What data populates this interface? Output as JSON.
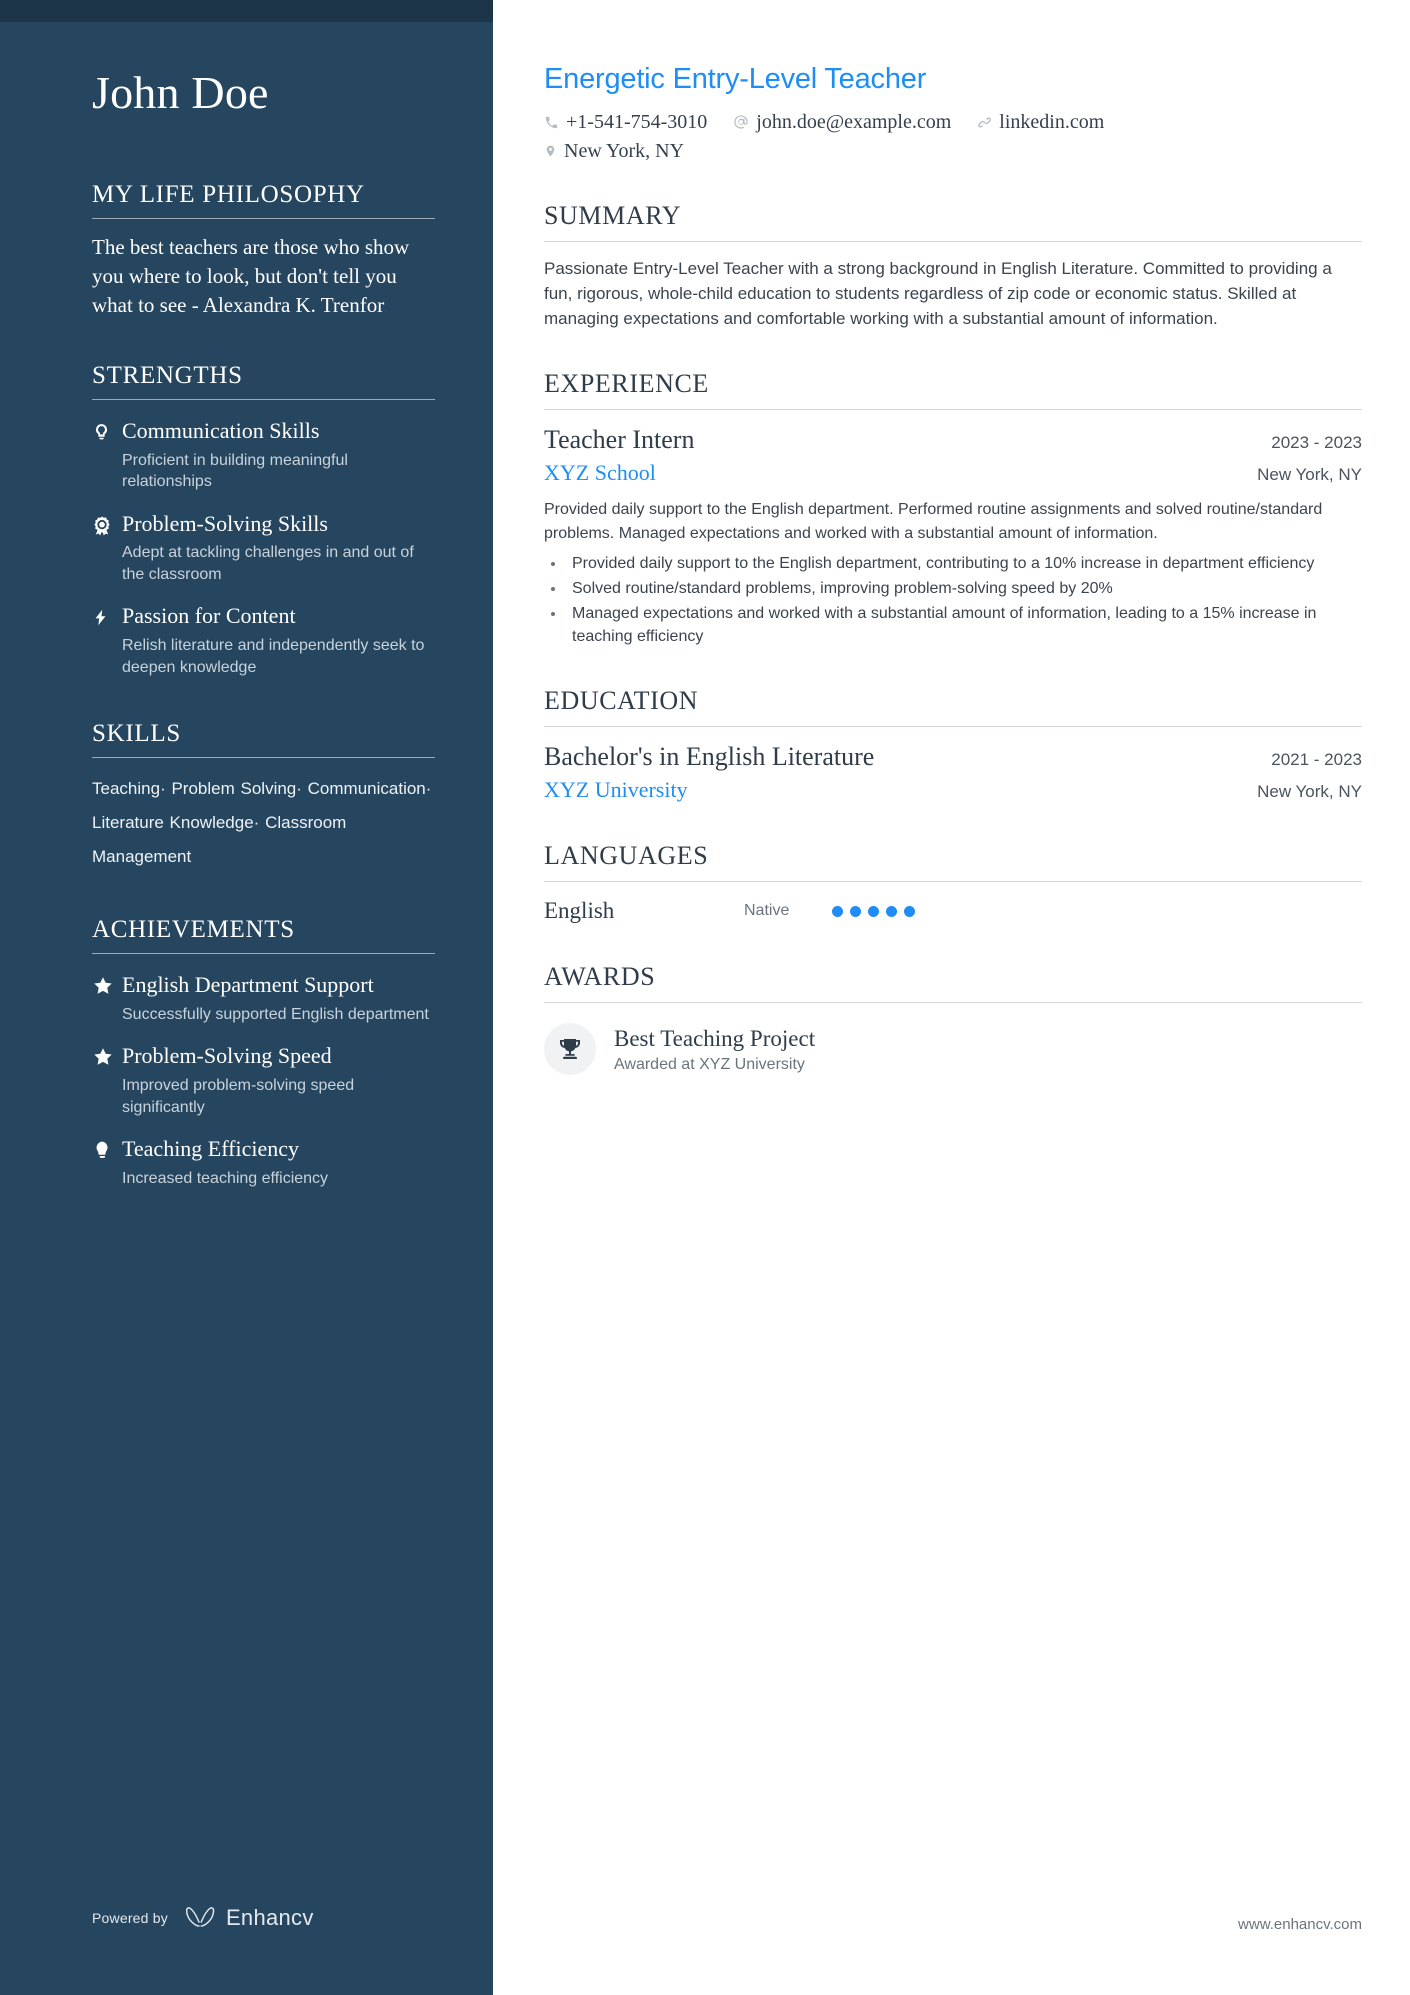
{
  "colors": {
    "sidebar_bg": "#26465f",
    "sidebar_top_band": "#1d3549",
    "accent_blue": "#1e8df5",
    "heading_dark": "#2f3c49",
    "body_text": "#3b444e",
    "muted_text": "#6b747d"
  },
  "sidebar": {
    "name": "John Doe",
    "philosophy": {
      "heading": "MY LIFE PHILOSOPHY",
      "quote": "The best teachers are those who show you where to look, but don't tell you what to see - Alexandra K. Trenfor"
    },
    "strengths": {
      "heading": "STRENGTHS",
      "items": [
        {
          "icon": "lightbulb-icon",
          "title": "Communication Skills",
          "description": "Proficient in building meaningful relationships"
        },
        {
          "icon": "award-ribbon-icon",
          "title": "Problem-Solving Skills",
          "description": "Adept at tackling challenges in and out of the classroom"
        },
        {
          "icon": "lightning-bolt-icon",
          "title": "Passion for Content",
          "description": "Relish literature and independently seek to deepen knowledge"
        }
      ]
    },
    "skills": {
      "heading": "SKILLS",
      "separator": "·",
      "items": [
        "Teaching",
        "Problem Solving",
        "Communication",
        "Literature Knowledge",
        "Classroom Management"
      ]
    },
    "achievements": {
      "heading": "ACHIEVEMENTS",
      "items": [
        {
          "icon": "star-icon",
          "title": "English Department Support",
          "description": "Successfully supported English department"
        },
        {
          "icon": "star-icon",
          "title": "Problem-Solving Speed",
          "description": "Improved problem-solving speed significantly"
        },
        {
          "icon": "lightbulb-idea-icon",
          "title": "Teaching Efficiency",
          "description": "Increased teaching efficiency"
        }
      ]
    },
    "footer": {
      "powered_by": "Powered by",
      "brand": "Enhancv"
    }
  },
  "main": {
    "job_title": "Energetic Entry-Level Teacher",
    "contacts": {
      "phone": {
        "icon": "phone-icon",
        "text": "+1-541-754-3010"
      },
      "email": {
        "icon": "at-email-icon",
        "text": "john.doe@example.com"
      },
      "link": {
        "icon": "link-icon",
        "text": "linkedin.com"
      },
      "location": {
        "icon": "map-pin-icon",
        "text": "New York, NY"
      }
    },
    "summary": {
      "heading": "SUMMARY",
      "text": "Passionate Entry-Level Teacher with a strong background in English Literature. Committed to providing a fun, rigorous, whole-child education to students regardless of zip code or economic status. Skilled at managing expectations and comfortable working with a substantial amount of information."
    },
    "experience": {
      "heading": "EXPERIENCE",
      "items": [
        {
          "title": "Teacher Intern",
          "dates": "2023 - 2023",
          "organization": "XYZ School",
          "location": "New York, NY",
          "description": "Provided daily support to the English department. Performed routine assignments and solved routine/standard problems. Managed expectations and worked with a substantial amount of information.",
          "bullets": [
            "Provided daily support to the English department, contributing to a 10% increase in department efficiency",
            "Solved routine/standard problems, improving problem-solving speed by 20%",
            "Managed expectations and worked with a substantial amount of information, leading to a 15% increase in teaching efficiency"
          ]
        }
      ]
    },
    "education": {
      "heading": "EDUCATION",
      "items": [
        {
          "title": "Bachelor's in English Literature",
          "dates": "2021 - 2023",
          "organization": "XYZ University",
          "location": "New York, NY"
        }
      ]
    },
    "languages": {
      "heading": "LANGUAGES",
      "items": [
        {
          "name": "English",
          "level": "Native",
          "rating": 5,
          "max_rating": 5
        }
      ]
    },
    "awards": {
      "heading": "AWARDS",
      "items": [
        {
          "icon": "trophy-icon",
          "title": "Best Teaching Project",
          "subtitle": "Awarded at XYZ University"
        }
      ]
    },
    "site_url": "www.enhancv.com"
  }
}
